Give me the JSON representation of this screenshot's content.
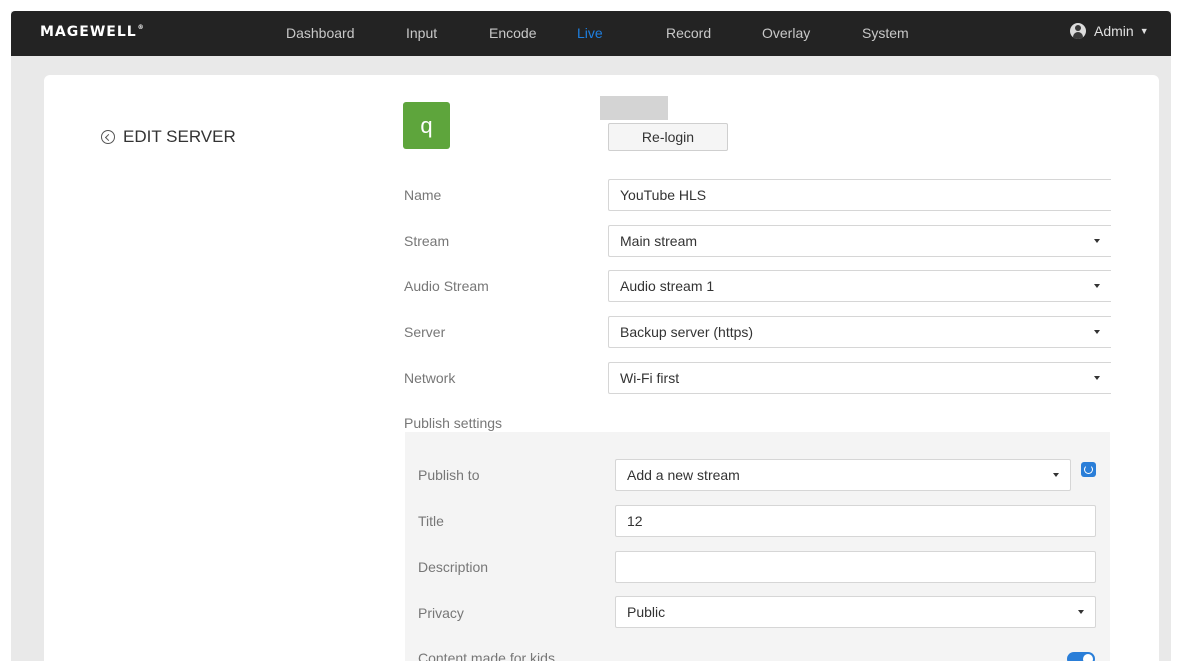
{
  "topbar": {
    "logo": "MAGEWELL",
    "nav": [
      "Dashboard",
      "Input",
      "Encode",
      "Live",
      "Record",
      "Overlay",
      "System"
    ],
    "active_nav": "Live",
    "user": "Admin"
  },
  "page": {
    "back_label": "EDIT SERVER",
    "avatar_letter": "q",
    "relogin_label": "Re-login"
  },
  "form": {
    "name_label": "Name",
    "name_value": "YouTube HLS",
    "stream_label": "Stream",
    "stream_value": "Main stream",
    "audio_label": "Audio Stream",
    "audio_value": "Audio stream 1",
    "server_label": "Server",
    "server_value": "Backup server (https)",
    "network_label": "Network",
    "network_value": "Wi-Fi first",
    "publish_heading": "Publish settings"
  },
  "publish": {
    "publish_to_label": "Publish to",
    "publish_to_value": "Add a new stream",
    "title_label": "Title",
    "title_value": "12",
    "description_label": "Description",
    "description_value": "",
    "privacy_label": "Privacy",
    "privacy_value": "Public",
    "kids_label": "Content made for kids",
    "kids_enabled": true
  },
  "colors": {
    "accent": "#2a7ed8",
    "topbar": "#232323",
    "avatar": "#5ea53c"
  }
}
